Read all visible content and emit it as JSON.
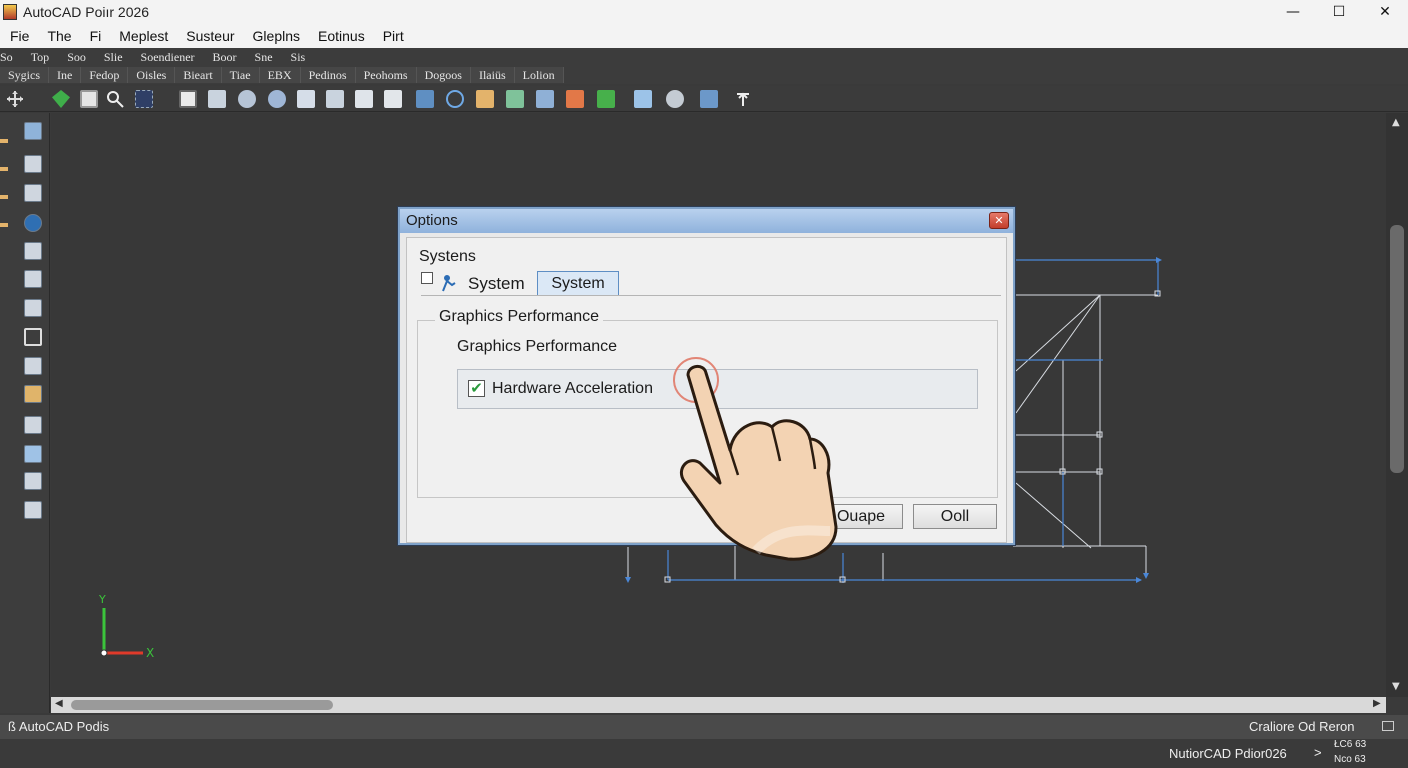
{
  "window": {
    "title": "AutoCAD Poiır 2026",
    "controls": {
      "minimize": "—",
      "maximize": "☐",
      "close": "✕"
    }
  },
  "menubar": {
    "items": [
      "Fie",
      "The",
      "Fi",
      "Meplest",
      "Susteur",
      "Gleplns",
      "Eotinus",
      "Pirt"
    ]
  },
  "ribbon_tabs_1": {
    "items": [
      "So",
      "Top",
      "Soo",
      "Slie",
      "Soendiener",
      "Boor",
      "Sne",
      "Sis"
    ]
  },
  "ribbon_tabs_2": {
    "items": [
      "Sygics",
      "Ine",
      "Fedop",
      "Oisles",
      "Bieart",
      "Tiae",
      "EBX",
      "Pedinos",
      "Peohoms",
      "Dogoos",
      "Ilaiüs",
      "Lolion"
    ]
  },
  "dialog": {
    "title": "Options",
    "close_label": "✕",
    "section": "Systens",
    "tab_label": "System",
    "tab_button": "System",
    "group_title": "Graphics Performance",
    "subgroup_title": "Graphics Performance",
    "hardware_checkbox": {
      "label": "Hardware Acceleration",
      "checked": true,
      "check_glyph": "✔"
    },
    "buttons": {
      "apply": "Ouape",
      "ok": "Ooll"
    }
  },
  "ucs": {
    "y_label": "Y",
    "x_label": "X"
  },
  "status": {
    "left": "ß AutoCAD Podis",
    "right": "Craliore Od Reron",
    "bottom_app": "NutiorCAD Pdior026",
    "arrow": ">",
    "coord_top": "ŁC6 63",
    "coord_bottom": "Nco 63"
  },
  "colors": {
    "drawing_line": "#4a87d8",
    "drawing_white": "#d9dde3",
    "dialog_border": "#7fa2c9",
    "checkbox_check": "#2a9a3c",
    "canvas": "#383838"
  },
  "icons": [
    "pan-icon",
    "layer-icon",
    "save-icon",
    "zoom-icon",
    "select-icon",
    "view-icon",
    "plot-icon",
    "hand-pointer-icon"
  ]
}
